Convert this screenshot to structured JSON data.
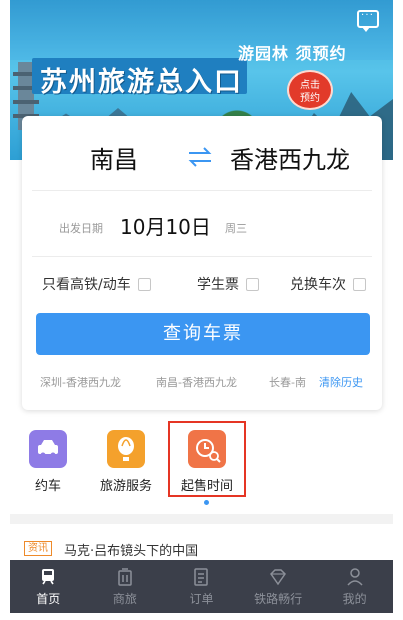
{
  "banner": {
    "title": "苏州旅游总入口",
    "slogan": "游园林 须预约",
    "badge_line1": "点击",
    "badge_line2": "预约"
  },
  "search": {
    "from_station": "南昌",
    "to_station": "香港西九龙",
    "date_label": "出发日期",
    "date_value": "10月10日",
    "weekday": "周三",
    "options": [
      {
        "label": "只看高铁/动车",
        "checked": false
      },
      {
        "label": "学生票",
        "checked": false
      },
      {
        "label": "兑换车次",
        "checked": false
      }
    ],
    "query_button": "查询车票",
    "history": [
      "深圳-香港西九龙",
      "南昌-香港西九龙",
      "长春-南"
    ],
    "clear_history": "清除历史"
  },
  "quick_menu": [
    {
      "label": "约车",
      "color": "#8e7be6",
      "icon": "car-icon"
    },
    {
      "label": "旅游服务",
      "color": "#f4a12c",
      "icon": "balloon-icon"
    },
    {
      "label": "起售时间",
      "color": "#f07447",
      "icon": "clock-search-icon"
    }
  ],
  "news": {
    "tag": "资讯",
    "title": "马克·吕布镜头下的中国"
  },
  "nav": [
    {
      "label": "首页",
      "icon": "train-icon",
      "active": true
    },
    {
      "label": "商旅",
      "icon": "trash-bag-icon",
      "active": false
    },
    {
      "label": "订单",
      "icon": "order-icon",
      "active": false
    },
    {
      "label": "铁路畅行",
      "icon": "diamond-icon",
      "active": false
    },
    {
      "label": "我的",
      "icon": "user-icon",
      "active": false
    }
  ],
  "colors": {
    "accent": "#3b96f2",
    "highlight": "#e53524",
    "nav_bg": "#3b3f4a"
  }
}
